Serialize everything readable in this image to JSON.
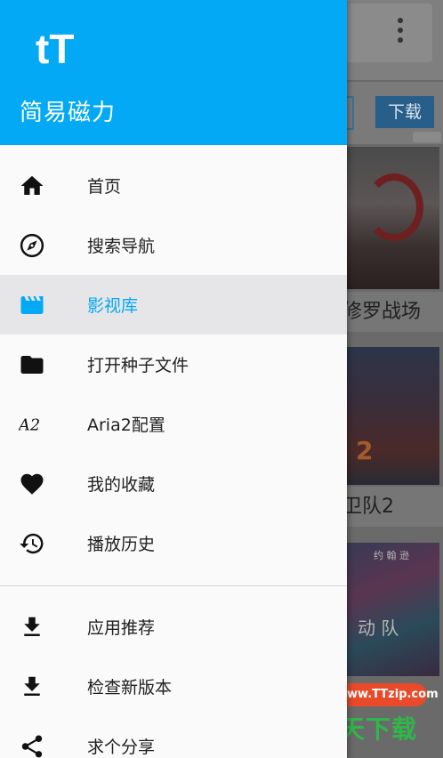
{
  "background": {
    "download_button": "下载",
    "card_captions": [
      "修罗战场",
      "卫队2"
    ],
    "poster_texts": [
      "动  队",
      "约  翰  逊"
    ]
  },
  "watermark": {
    "big_char": "天",
    "text": "天下载",
    "url": "www.TTzip.com"
  },
  "drawer": {
    "logo": "tT",
    "app_name": "简易磁力",
    "accent_color": "#03a9f4",
    "items": [
      {
        "label": "首页",
        "icon": "home-icon",
        "active": false
      },
      {
        "label": "搜索导航",
        "icon": "compass-icon",
        "active": false
      },
      {
        "label": "影视库",
        "icon": "movie-icon",
        "active": true
      },
      {
        "label": "打开种子文件",
        "icon": "folder-icon",
        "active": false
      },
      {
        "label": "Aria2配置",
        "icon": "aria2-icon",
        "active": false
      },
      {
        "label": "我的收藏",
        "icon": "heart-icon",
        "active": false
      },
      {
        "label": "播放历史",
        "icon": "history-icon",
        "active": false
      }
    ],
    "extra_items": [
      {
        "label": "应用推荐",
        "icon": "download-icon"
      },
      {
        "label": "检查新版本",
        "icon": "download-icon"
      },
      {
        "label": "求个分享",
        "icon": "share-icon"
      }
    ]
  }
}
